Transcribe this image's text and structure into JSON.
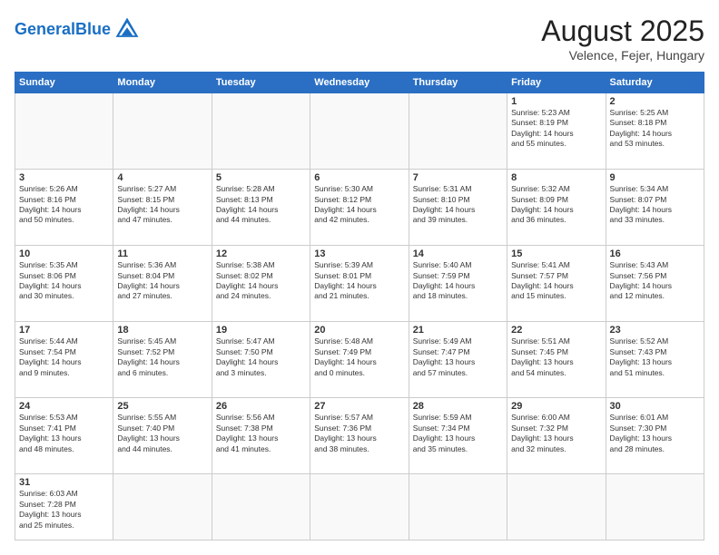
{
  "header": {
    "logo_general": "General",
    "logo_blue": "Blue",
    "month_year": "August 2025",
    "location": "Velence, Fejer, Hungary"
  },
  "weekdays": [
    "Sunday",
    "Monday",
    "Tuesday",
    "Wednesday",
    "Thursday",
    "Friday",
    "Saturday"
  ],
  "weeks": [
    [
      {
        "day": "",
        "info": ""
      },
      {
        "day": "",
        "info": ""
      },
      {
        "day": "",
        "info": ""
      },
      {
        "day": "",
        "info": ""
      },
      {
        "day": "",
        "info": ""
      },
      {
        "day": "1",
        "info": "Sunrise: 5:23 AM\nSunset: 8:19 PM\nDaylight: 14 hours\nand 55 minutes."
      },
      {
        "day": "2",
        "info": "Sunrise: 5:25 AM\nSunset: 8:18 PM\nDaylight: 14 hours\nand 53 minutes."
      }
    ],
    [
      {
        "day": "3",
        "info": "Sunrise: 5:26 AM\nSunset: 8:16 PM\nDaylight: 14 hours\nand 50 minutes."
      },
      {
        "day": "4",
        "info": "Sunrise: 5:27 AM\nSunset: 8:15 PM\nDaylight: 14 hours\nand 47 minutes."
      },
      {
        "day": "5",
        "info": "Sunrise: 5:28 AM\nSunset: 8:13 PM\nDaylight: 14 hours\nand 44 minutes."
      },
      {
        "day": "6",
        "info": "Sunrise: 5:30 AM\nSunset: 8:12 PM\nDaylight: 14 hours\nand 42 minutes."
      },
      {
        "day": "7",
        "info": "Sunrise: 5:31 AM\nSunset: 8:10 PM\nDaylight: 14 hours\nand 39 minutes."
      },
      {
        "day": "8",
        "info": "Sunrise: 5:32 AM\nSunset: 8:09 PM\nDaylight: 14 hours\nand 36 minutes."
      },
      {
        "day": "9",
        "info": "Sunrise: 5:34 AM\nSunset: 8:07 PM\nDaylight: 14 hours\nand 33 minutes."
      }
    ],
    [
      {
        "day": "10",
        "info": "Sunrise: 5:35 AM\nSunset: 8:06 PM\nDaylight: 14 hours\nand 30 minutes."
      },
      {
        "day": "11",
        "info": "Sunrise: 5:36 AM\nSunset: 8:04 PM\nDaylight: 14 hours\nand 27 minutes."
      },
      {
        "day": "12",
        "info": "Sunrise: 5:38 AM\nSunset: 8:02 PM\nDaylight: 14 hours\nand 24 minutes."
      },
      {
        "day": "13",
        "info": "Sunrise: 5:39 AM\nSunset: 8:01 PM\nDaylight: 14 hours\nand 21 minutes."
      },
      {
        "day": "14",
        "info": "Sunrise: 5:40 AM\nSunset: 7:59 PM\nDaylight: 14 hours\nand 18 minutes."
      },
      {
        "day": "15",
        "info": "Sunrise: 5:41 AM\nSunset: 7:57 PM\nDaylight: 14 hours\nand 15 minutes."
      },
      {
        "day": "16",
        "info": "Sunrise: 5:43 AM\nSunset: 7:56 PM\nDaylight: 14 hours\nand 12 minutes."
      }
    ],
    [
      {
        "day": "17",
        "info": "Sunrise: 5:44 AM\nSunset: 7:54 PM\nDaylight: 14 hours\nand 9 minutes."
      },
      {
        "day": "18",
        "info": "Sunrise: 5:45 AM\nSunset: 7:52 PM\nDaylight: 14 hours\nand 6 minutes."
      },
      {
        "day": "19",
        "info": "Sunrise: 5:47 AM\nSunset: 7:50 PM\nDaylight: 14 hours\nand 3 minutes."
      },
      {
        "day": "20",
        "info": "Sunrise: 5:48 AM\nSunset: 7:49 PM\nDaylight: 14 hours\nand 0 minutes."
      },
      {
        "day": "21",
        "info": "Sunrise: 5:49 AM\nSunset: 7:47 PM\nDaylight: 13 hours\nand 57 minutes."
      },
      {
        "day": "22",
        "info": "Sunrise: 5:51 AM\nSunset: 7:45 PM\nDaylight: 13 hours\nand 54 minutes."
      },
      {
        "day": "23",
        "info": "Sunrise: 5:52 AM\nSunset: 7:43 PM\nDaylight: 13 hours\nand 51 minutes."
      }
    ],
    [
      {
        "day": "24",
        "info": "Sunrise: 5:53 AM\nSunset: 7:41 PM\nDaylight: 13 hours\nand 48 minutes."
      },
      {
        "day": "25",
        "info": "Sunrise: 5:55 AM\nSunset: 7:40 PM\nDaylight: 13 hours\nand 44 minutes."
      },
      {
        "day": "26",
        "info": "Sunrise: 5:56 AM\nSunset: 7:38 PM\nDaylight: 13 hours\nand 41 minutes."
      },
      {
        "day": "27",
        "info": "Sunrise: 5:57 AM\nSunset: 7:36 PM\nDaylight: 13 hours\nand 38 minutes."
      },
      {
        "day": "28",
        "info": "Sunrise: 5:59 AM\nSunset: 7:34 PM\nDaylight: 13 hours\nand 35 minutes."
      },
      {
        "day": "29",
        "info": "Sunrise: 6:00 AM\nSunset: 7:32 PM\nDaylight: 13 hours\nand 32 minutes."
      },
      {
        "day": "30",
        "info": "Sunrise: 6:01 AM\nSunset: 7:30 PM\nDaylight: 13 hours\nand 28 minutes."
      }
    ],
    [
      {
        "day": "31",
        "info": "Sunrise: 6:03 AM\nSunset: 7:28 PM\nDaylight: 13 hours\nand 25 minutes."
      },
      {
        "day": "",
        "info": ""
      },
      {
        "day": "",
        "info": ""
      },
      {
        "day": "",
        "info": ""
      },
      {
        "day": "",
        "info": ""
      },
      {
        "day": "",
        "info": ""
      },
      {
        "day": "",
        "info": ""
      }
    ]
  ]
}
